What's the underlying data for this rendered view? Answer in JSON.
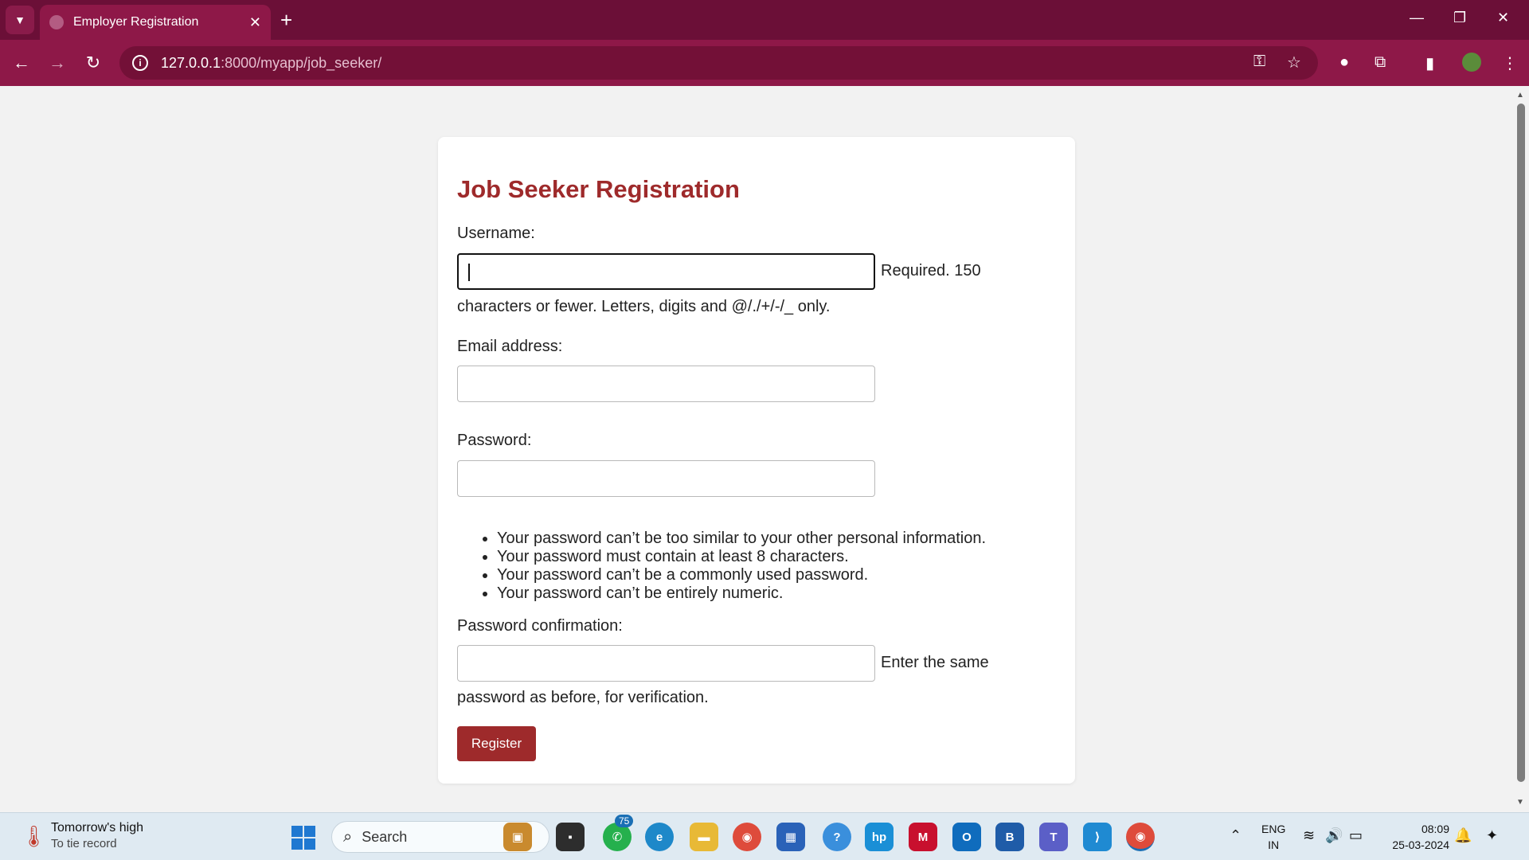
{
  "browser": {
    "tab_title": "Employer Registration",
    "tab_close": "✕",
    "new_tab": "+",
    "url_host": "127.0.0.1",
    "url_path": ":8000/myapp/job_seeker/",
    "minimize": "—",
    "restore": "❐",
    "close": "✕"
  },
  "form": {
    "heading": "Job Seeker Registration",
    "username_label": "Username:",
    "username_help_inline": "Required. 150",
    "username_help_rest": "characters or fewer. Letters, digits and @/./+/-/_ only.",
    "email_label": "Email address:",
    "password_label": "Password:",
    "password_rules": [
      "Your password can’t be too similar to your other personal information.",
      "Your password must contain at least 8 characters.",
      "Your password can’t be a commonly used password.",
      "Your password can’t be entirely numeric."
    ],
    "confirm_label": "Password confirmation:",
    "confirm_help_inline": "Enter the same",
    "confirm_help_rest": "password as before, for verification.",
    "submit_label": "Register",
    "accent_color": "#9e2a2b"
  },
  "taskbar": {
    "weather_title": "Tomorrow's high",
    "weather_sub": "To tie record",
    "search_placeholder": "Search",
    "whatsapp_badge": "75",
    "lang_top": "ENG",
    "lang_bottom": "IN",
    "time": "08:09",
    "date": "25-03-2024"
  }
}
